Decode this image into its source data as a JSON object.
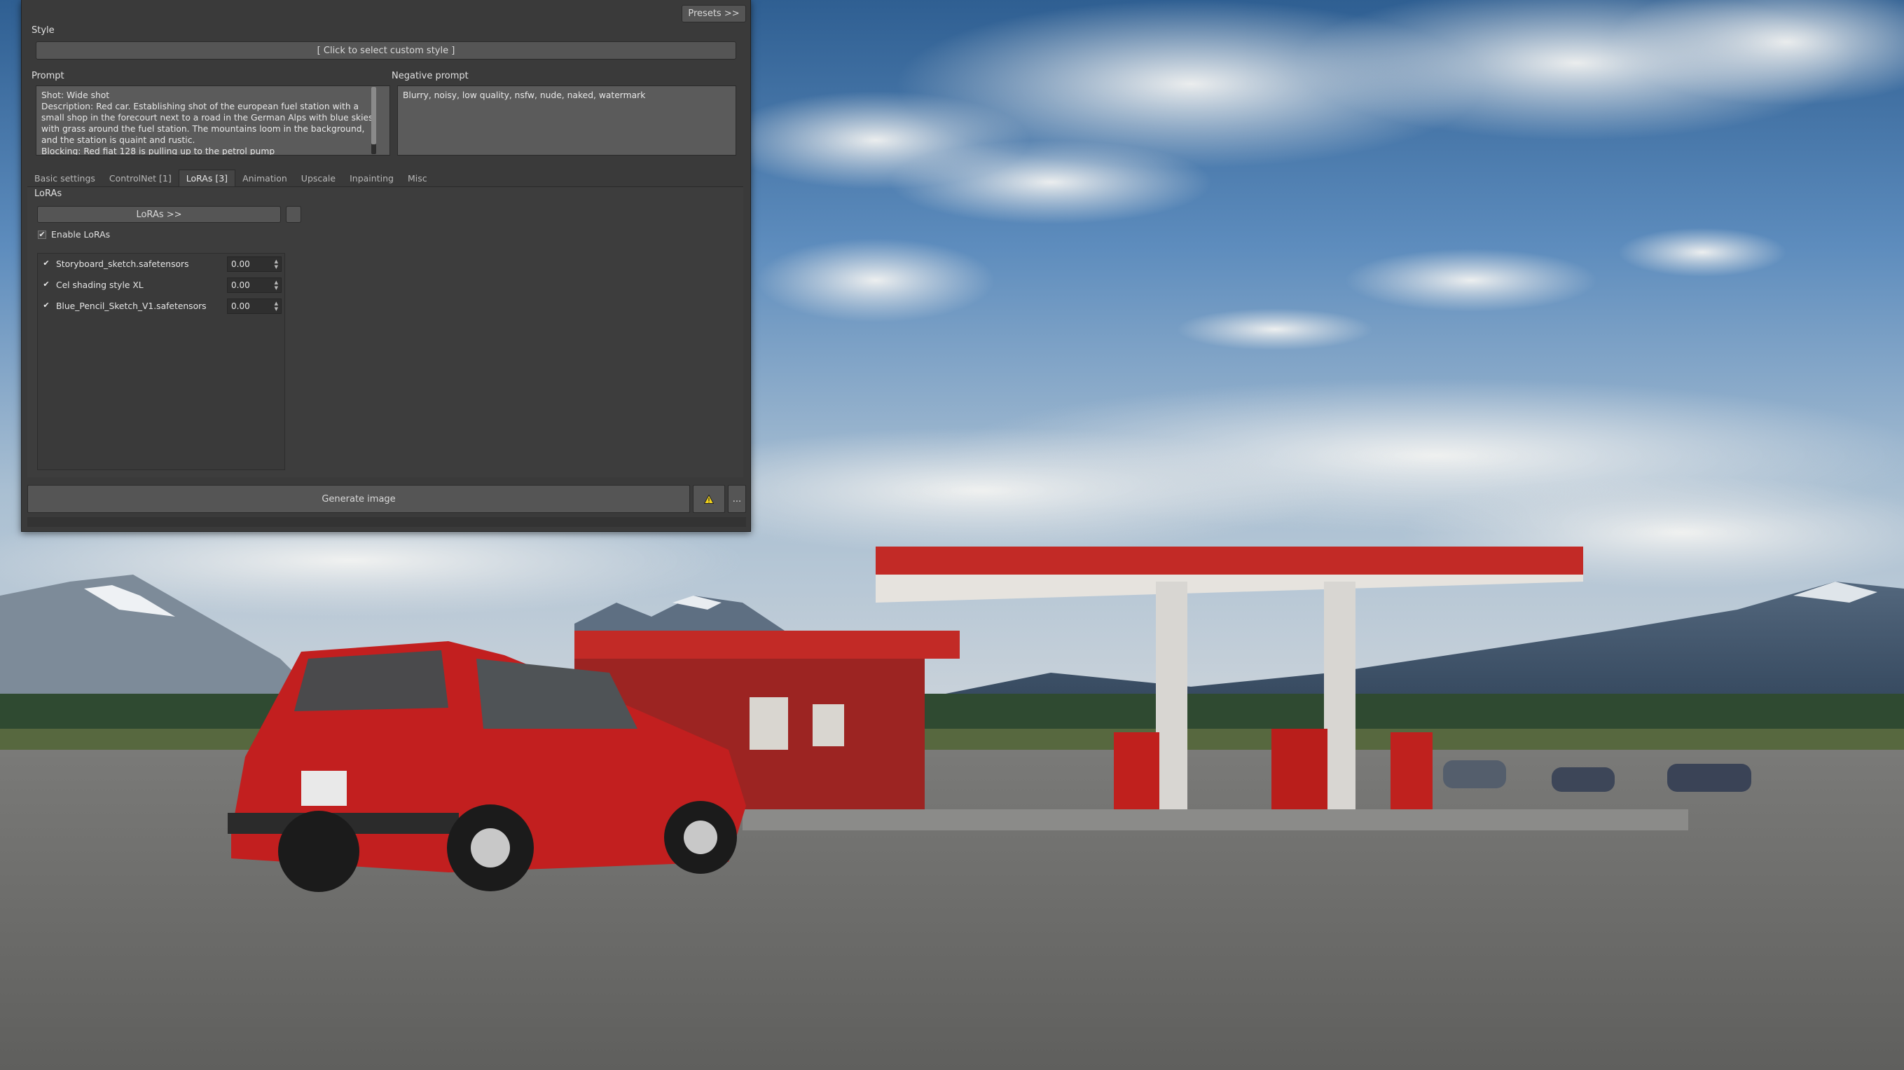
{
  "panel": {
    "presets_label": "Presets >>",
    "style": {
      "label": "Style",
      "button_label": "[ Click to select custom style ]"
    },
    "prompt": {
      "label": "Prompt",
      "value": "Shot: Wide shot\nDescription: Red car. Establishing shot of the european fuel station with a small shop in the forecourt next to a road in the German Alps with blue skies with grass around the fuel station. The mountains loom in the background, and the station is quaint and rustic.\nBlocking: Red fiat 128 is pulling up to the petrol pump"
    },
    "negative_prompt": {
      "label": "Negative prompt",
      "value": "Blurry, noisy, low quality, nsfw, nude, naked, watermark"
    },
    "tabs": [
      {
        "label": "Basic settings",
        "active": false
      },
      {
        "label": "ControlNet [1]",
        "active": false
      },
      {
        "label": "LoRAs [3]",
        "active": true
      },
      {
        "label": "Animation",
        "active": false
      },
      {
        "label": "Upscale",
        "active": false
      },
      {
        "label": "Inpainting",
        "active": false
      },
      {
        "label": "Misc",
        "active": false
      }
    ],
    "loras": {
      "section_label": "LoRAs",
      "button_label": "LoRAs >>",
      "enable_label": "Enable LoRAs",
      "enabled": true,
      "check_glyph": "✔",
      "items": [
        {
          "name": "Storyboard_sketch.safetensors",
          "weight": "0.00",
          "checked": true
        },
        {
          "name": "Cel shading style XL",
          "weight": "0.00",
          "checked": true
        },
        {
          "name": "Blue_Pencil_Sketch_V1.safetensors",
          "weight": "0.00",
          "checked": true
        }
      ]
    },
    "generate_label": "Generate image",
    "warning_icon": "warning-icon",
    "more_label": "..."
  },
  "colors": {
    "panel_bg": "#3a3a3a",
    "warning": "#f2d21b",
    "car_red": "#c21f1f"
  }
}
